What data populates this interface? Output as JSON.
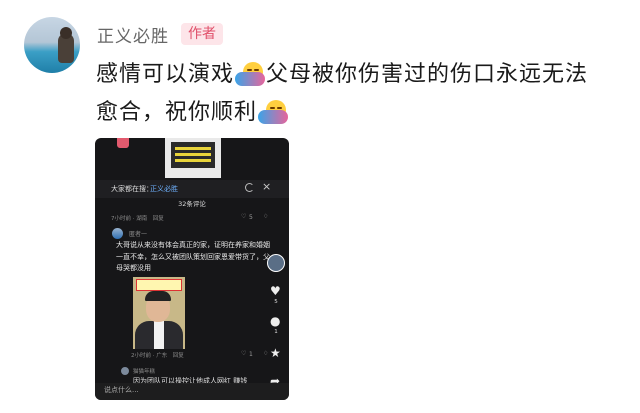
{
  "author": {
    "name": "正义必胜",
    "tag": "作者"
  },
  "post": {
    "line1_part1": "感情可以演戏",
    "line1_part2": "父母被你伤害过的伤口永远无法",
    "line2": "愈合，祝你顺利",
    "emoji": "hug-emoji"
  },
  "screenshot": {
    "search_label": "大家都在搜：",
    "search_keyword": "正义必胜",
    "comment_count": "32条评论",
    "first_meta": "7小时前 · 湖南　回复",
    "first_likes": "5",
    "comment": {
      "user": "匿者一",
      "text": "大哥说从来没有体会真正的家，证明在养家和婚姻一直不幸，怎么又被团队策划回家恩爱带货了，父母哭都没用",
      "thumb_caption": "与来者相见",
      "meta": "2小时前 · 广东　回复",
      "likes": "1"
    },
    "reply": {
      "user": "猫猫年糕",
      "text": "因为团队可以操控让他成人网红 赚钱"
    },
    "sidebar": {
      "likes": "5",
      "comments": "1"
    },
    "compose_placeholder": "说点什么..."
  }
}
